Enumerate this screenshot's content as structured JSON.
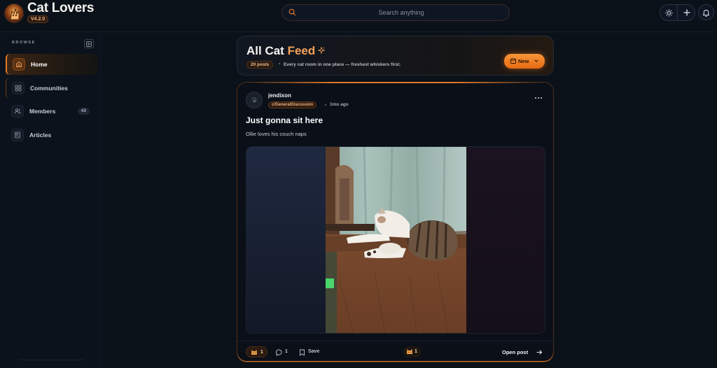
{
  "app": {
    "title": "Cat Lovers",
    "version": "V4.2.0"
  },
  "search": {
    "placeholder": "Search anything",
    "value": ""
  },
  "sidebar": {
    "section_label": "BROWSE",
    "items": [
      {
        "label": "Home",
        "icon": "home-icon",
        "active": true
      },
      {
        "label": "Communities",
        "icon": "grid-icon",
        "active": false
      },
      {
        "label": "Members",
        "icon": "users-icon",
        "active": false,
        "count": "43"
      },
      {
        "label": "Articles",
        "icon": "articles-icon",
        "active": false
      }
    ]
  },
  "feed": {
    "title_main": "All Cat",
    "title_accent": "Feed",
    "post_count": "20 posts",
    "subtitle": "Every cat room in one place — freshest whiskers first.",
    "sort_label": "New"
  },
  "post": {
    "author": "jendixon",
    "community": "c/GeneralDiscussion",
    "time": "1mo ago",
    "title": "Just gonna sit here",
    "body": "Ollie loves his couch naps",
    "reactions": "1",
    "comments": "1",
    "save_label": "Save",
    "reaction_summary": "1",
    "open_label": "Open post"
  },
  "colors": {
    "accent": "#e07a2a",
    "background": "#0b1119",
    "card": "#0a0f18"
  }
}
